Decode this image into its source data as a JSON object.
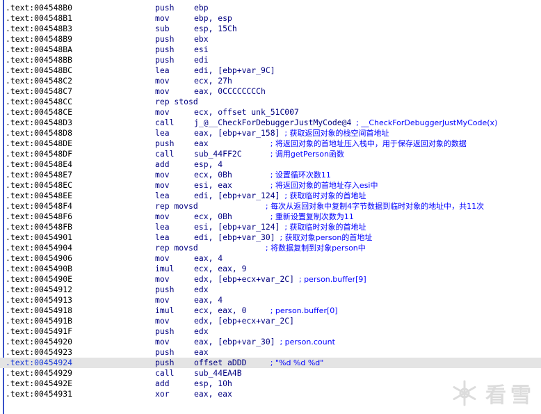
{
  "rows": [
    {
      "addr": ".text:004548B0",
      "mnem": "push",
      "ops": "ebp"
    },
    {
      "addr": ".text:004548B1",
      "mnem": "mov",
      "ops": "ebp, esp"
    },
    {
      "addr": ".text:004548B3",
      "mnem": "sub",
      "ops": "esp, 15Ch"
    },
    {
      "addr": ".text:004548B9",
      "mnem": "push",
      "ops": "ebx"
    },
    {
      "addr": ".text:004548BA",
      "mnem": "push",
      "ops": "esi"
    },
    {
      "addr": ".text:004548BB",
      "mnem": "push",
      "ops": "edi"
    },
    {
      "addr": ".text:004548BC",
      "mnem": "lea",
      "ops": "edi, [ebp+var_9C]"
    },
    {
      "addr": ".text:004548C2",
      "mnem": "mov",
      "ops": "ecx, 27h"
    },
    {
      "addr": ".text:004548C7",
      "mnem": "mov",
      "ops": "eax, 0CCCCCCCCh"
    },
    {
      "addr": ".text:004548CC",
      "mnem": "rep stosd",
      "ops": ""
    },
    {
      "addr": ".text:004548CE",
      "mnem": "mov",
      "ops": "ecx, offset unk_51C007"
    },
    {
      "addr": ".text:004548D3",
      "mnem": "call",
      "ops": "j_@__CheckForDebuggerJustMyCode@4 ; __CheckForDebuggerJustMyCode(x)"
    },
    {
      "addr": ".text:004548D8",
      "mnem": "lea",
      "ops": "eax, [ebp+var_158] ; 获取返回对象的栈空间首地址"
    },
    {
      "addr": ".text:004548DE",
      "mnem": "push",
      "ops": "eax             ; 将返回对象的首地址压入栈中，用于保存返回对象的数据"
    },
    {
      "addr": ".text:004548DF",
      "mnem": "call",
      "ops": "sub_44FF2C      ; 调用getPerson函数"
    },
    {
      "addr": ".text:004548E4",
      "mnem": "add",
      "ops": "esp, 4"
    },
    {
      "addr": ".text:004548E7",
      "mnem": "mov",
      "ops": "ecx, 0Bh        ; 设置循环次数11"
    },
    {
      "addr": ".text:004548EC",
      "mnem": "mov",
      "ops": "esi, eax        ; 将返回对象的首地址存入esi中"
    },
    {
      "addr": ".text:004548EE",
      "mnem": "lea",
      "ops": "edi, [ebp+var_124] ; 获取临时对象的首地址"
    },
    {
      "addr": ".text:004548F4",
      "mnem": "rep movsd",
      "ops": "               ; 每次从返回对象中复制4字节数据到临时对象的地址中，共11次"
    },
    {
      "addr": ".text:004548F6",
      "mnem": "mov",
      "ops": "ecx, 0Bh        ; 重新设置复制次数为11"
    },
    {
      "addr": ".text:004548FB",
      "mnem": "lea",
      "ops": "esi, [ebp+var_124] ; 获取临时对象的首地址"
    },
    {
      "addr": ".text:00454901",
      "mnem": "lea",
      "ops": "edi, [ebp+var_30] ; 获取对象person的首地址"
    },
    {
      "addr": ".text:00454904",
      "mnem": "rep movsd",
      "ops": "               ; 将数据复制到对象person中"
    },
    {
      "addr": ".text:00454906",
      "mnem": "mov",
      "ops": "eax, 4"
    },
    {
      "addr": ".text:0045490B",
      "mnem": "imul",
      "ops": "ecx, eax, 9"
    },
    {
      "addr": ".text:0045490E",
      "mnem": "mov",
      "ops": "edx, [ebp+ecx+var_2C] ; person.buffer[9]"
    },
    {
      "addr": ".text:00454912",
      "mnem": "push",
      "ops": "edx"
    },
    {
      "addr": ".text:00454913",
      "mnem": "mov",
      "ops": "eax, 4"
    },
    {
      "addr": ".text:00454918",
      "mnem": "imul",
      "ops": "ecx, eax, 0     ; person.buffer[0]"
    },
    {
      "addr": ".text:0045491B",
      "mnem": "mov",
      "ops": "edx, [ebp+ecx+var_2C]"
    },
    {
      "addr": ".text:0045491F",
      "mnem": "push",
      "ops": "edx"
    },
    {
      "addr": ".text:00454920",
      "mnem": "mov",
      "ops": "eax, [ebp+var_30] ; person.count"
    },
    {
      "addr": ".text:00454923",
      "mnem": "push",
      "ops": "eax"
    },
    {
      "addr": ".text:00454924",
      "mnem": "push",
      "ops": "offset aDDD     ; \"%d %d %d\"",
      "highlight": true
    },
    {
      "addr": ".text:00454929",
      "mnem": "call",
      "ops": "sub_44EA4B"
    },
    {
      "addr": ".text:0045492E",
      "mnem": "add",
      "ops": "esp, 10h"
    },
    {
      "addr": ".text:00454931",
      "mnem": "xor",
      "ops": "eax, eax"
    }
  ],
  "watermark": {
    "text": "看雪",
    "icon": "snowflake-logo-icon"
  }
}
